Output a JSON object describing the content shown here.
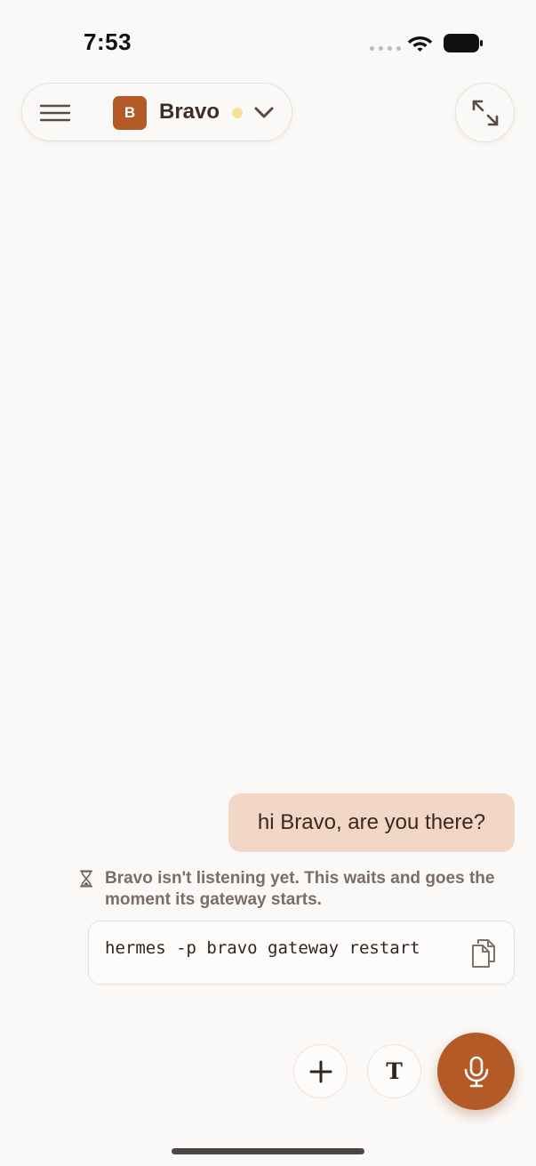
{
  "status_bar": {
    "time": "7:53"
  },
  "header": {
    "agent_initial": "B",
    "agent_name": "Bravo",
    "status_dot_color": "#f5e29a",
    "accent_color": "#b45a27",
    "menu_icon": "hamburger-icon",
    "dropdown_icon": "chevron-down-icon",
    "expand_icon": "expand-arrows-icon"
  },
  "conversation": {
    "user_message": "hi Bravo, are you there?",
    "notice_icon": "hourglass-icon",
    "notice_text": "Bravo isn't listening yet. This waits and goes the moment its gateway starts.",
    "command": "hermes -p bravo gateway restart",
    "copy_icon": "copy-icon"
  },
  "composer": {
    "add_icon": "plus-icon",
    "text_label": "T",
    "mic_icon": "microphone-icon"
  }
}
